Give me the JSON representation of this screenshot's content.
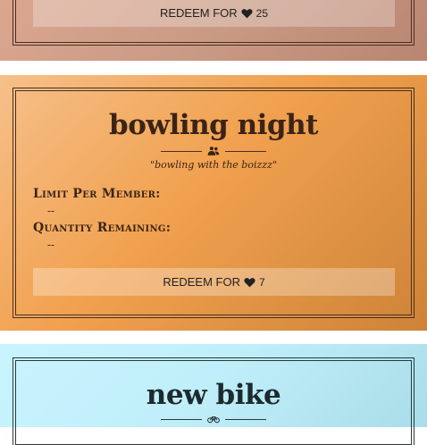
{
  "rewards": [
    {
      "redeem_prefix": "REDEEM FOR",
      "cost": "25",
      "currency_icon": "heart-icon"
    },
    {
      "title": "bowling night",
      "divider_icon": "users-icon",
      "tagline": "\"bowling with the boizzz\"",
      "limit_label": "Limit Per Member:",
      "limit_value": "--",
      "quantity_label": "Quantity Remaining:",
      "quantity_value": "--",
      "redeem_prefix": "REDEEM FOR",
      "cost": "7",
      "currency_icon": "heart-icon"
    },
    {
      "title": "new bike",
      "divider_icon": "bicycle-icon"
    }
  ],
  "colors": {
    "card_1_bg": "#c99a84",
    "card_2_bg": "#f1a14f",
    "card_3_bg": "#bfeef9",
    "ink": "#3b2416"
  }
}
